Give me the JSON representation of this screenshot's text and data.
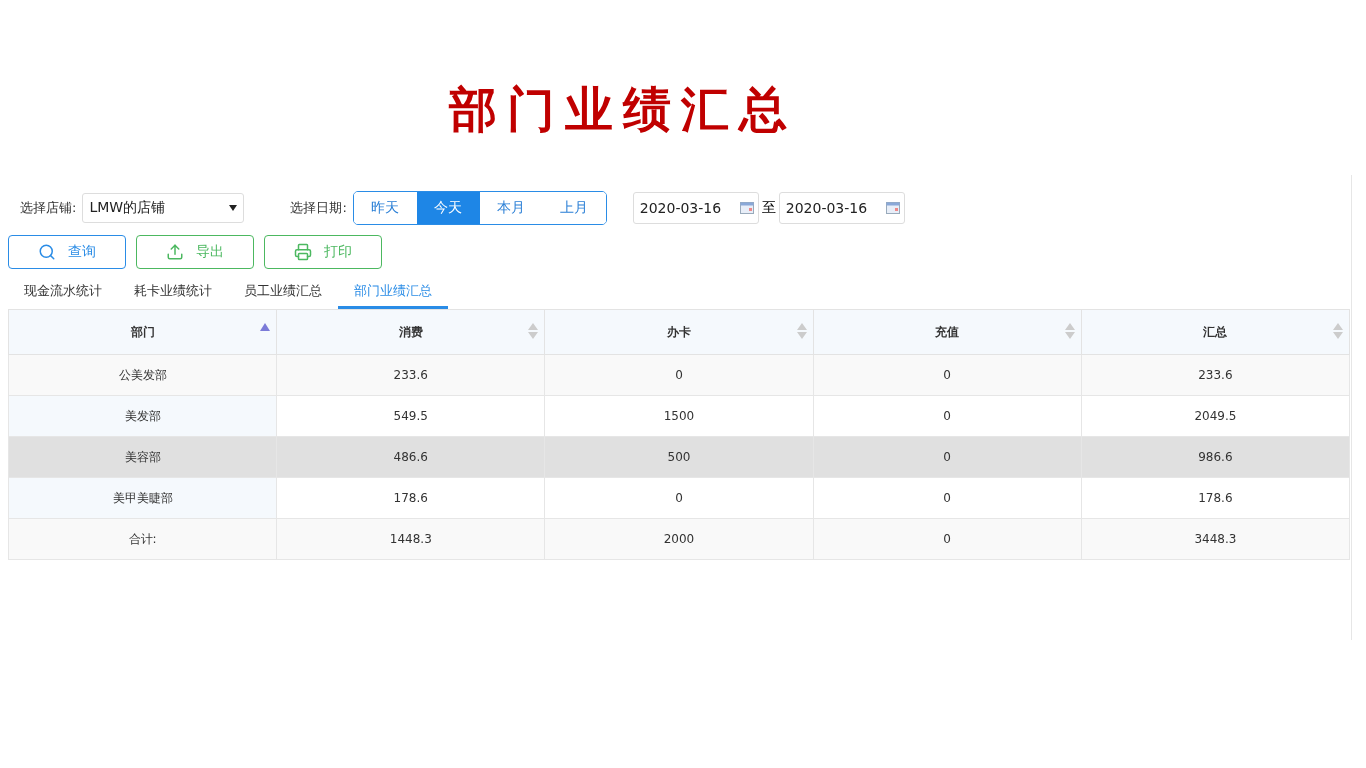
{
  "title": "部门业绩汇总",
  "store": {
    "label": "选择店铺:",
    "value": "LMW的店铺"
  },
  "date": {
    "label": "选择日期:",
    "options": [
      {
        "label": "昨天",
        "selected": false
      },
      {
        "label": "今天",
        "selected": true
      },
      {
        "label": "本月",
        "selected": false
      },
      {
        "label": "上月",
        "selected": false
      }
    ],
    "from": "2020-03-16",
    "separator": "至",
    "to": "2020-03-16"
  },
  "buttons": [
    {
      "kind": "search",
      "label": "查询"
    },
    {
      "kind": "export",
      "label": "导出"
    },
    {
      "kind": "print",
      "label": "打印"
    }
  ],
  "tabs": [
    {
      "label": "现金流水统计",
      "selected": false
    },
    {
      "label": "耗卡业绩统计",
      "selected": false
    },
    {
      "label": "员工业绩汇总",
      "selected": false
    },
    {
      "label": "部门业绩汇总",
      "selected": true
    }
  ],
  "table": {
    "columns": [
      {
        "label": "部门",
        "sorted": true
      },
      {
        "label": "消费",
        "sorted": false
      },
      {
        "label": "办卡",
        "sorted": false
      },
      {
        "label": "充值",
        "sorted": false
      },
      {
        "label": "汇总",
        "sorted": false
      }
    ],
    "rows": [
      {
        "cells": [
          "公美发部",
          "233.6",
          "0",
          "0",
          "233.6"
        ],
        "highlighted": false
      },
      {
        "cells": [
          "美发部",
          "549.5",
          "1500",
          "0",
          "2049.5"
        ],
        "highlighted": false
      },
      {
        "cells": [
          "美容部",
          "486.6",
          "500",
          "0",
          "986.6"
        ],
        "highlighted": true
      },
      {
        "cells": [
          "美甲美睫部",
          "178.6",
          "0",
          "0",
          "178.6"
        ],
        "highlighted": false
      },
      {
        "cells": [
          "合计:",
          "1448.3",
          "2000",
          "0",
          "3448.3"
        ],
        "highlighted": false
      }
    ]
  }
}
